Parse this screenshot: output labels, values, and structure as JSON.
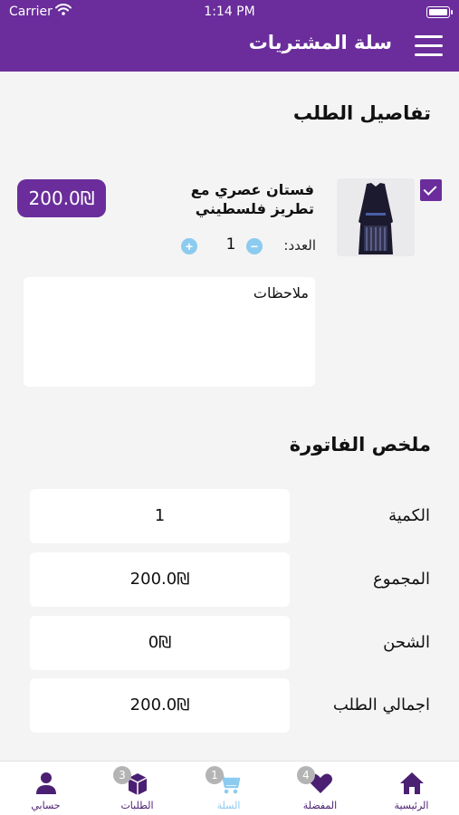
{
  "status_bar": {
    "carrier": "Carrier",
    "time": "1:14 PM"
  },
  "header": {
    "title": "سلة المشتريات",
    "menu_icon": "hamburger-menu-icon",
    "background": "#6a2d9b"
  },
  "order_details": {
    "title": "تفاصيل الطلب",
    "item": {
      "selected": true,
      "name": "فستان  عصري مع تطريز فلسطيني",
      "price": "200.0₪",
      "quantity_label": "العدد:",
      "quantity": "1"
    },
    "notes_placeholder": "ملاحظات"
  },
  "invoice": {
    "title": "ملخص الفاتورة",
    "rows": [
      {
        "label": "الكمية",
        "value": "1"
      },
      {
        "label": "المجموع",
        "value": "200.0₪"
      },
      {
        "label": "الشحن",
        "value": "0₪"
      },
      {
        "label": "اجمالي الطلب",
        "value": "200.0₪"
      }
    ]
  },
  "tab_bar": {
    "items": [
      {
        "label": "حسابي",
        "icon": "user-icon",
        "color": "#4b1f72"
      },
      {
        "label": "الطلبات",
        "icon": "box-icon",
        "badge": "3",
        "color": "#4b1f72"
      },
      {
        "label": "السلة",
        "icon": "cart-icon",
        "badge": "1",
        "color": "#8ccbf0",
        "active": true
      },
      {
        "label": "المفضلة",
        "icon": "heart-icon",
        "badge": "4",
        "color": "#4b1f72"
      },
      {
        "label": "الرئيسية",
        "icon": "home-icon",
        "color": "#4b1f72"
      }
    ]
  },
  "colors": {
    "primary": "#6a2d9b",
    "accent": "#8ccbf0",
    "background": "#f4f4f4"
  }
}
